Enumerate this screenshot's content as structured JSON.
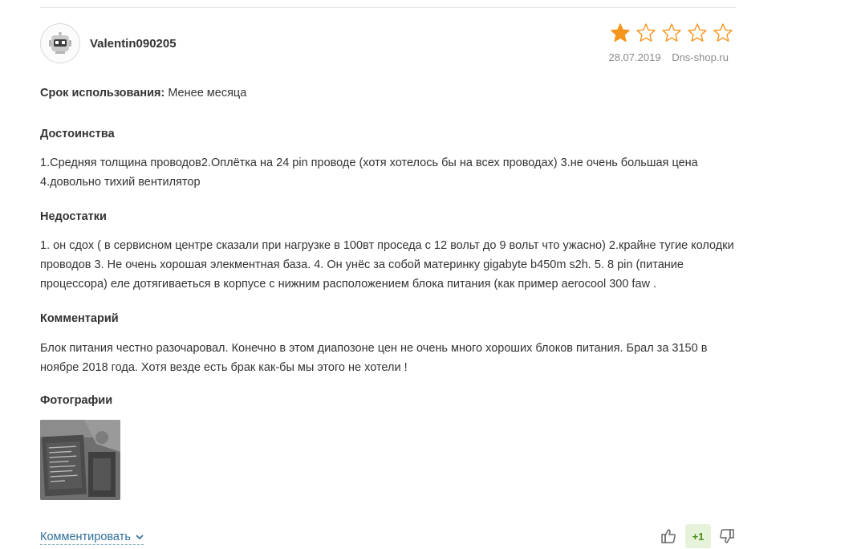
{
  "review": {
    "username": "Valentin090205",
    "rating": 1,
    "rating_max": 5,
    "date": "28.07.2019",
    "source": "Dns-shop.ru",
    "usage_label": "Срок использования:",
    "usage_value": "Менее месяца"
  },
  "sections": {
    "pros": {
      "title": "Достоинства",
      "text": "1.Средняя толщина проводов2.Оплётка на 24 pin проводе (хотя хотелось бы на всех проводах) 3.не очень большая цена 4.довольно тихий вентилятор"
    },
    "cons": {
      "title": "Недостатки",
      "text": "1. он сдох ( в сервисном центре сказали при нагрузке в 100вт проседа с 12 вольт до 9 вольт что ужасно) 2.крайне тугие колодки проводов 3. Не очень хорошая элекментная база. 4. Он унёс за собой материнку gigabyte b450m s2h. 5. 8 pin (питание процессора) еле дотягиваеться в корпусе с нижним расположением блока питания (как пример aerocool 300 faw ."
    },
    "comment": {
      "title": "Комментарий",
      "text": "Блок питания честно разочаровал.  Конечно в этом диапозоне цен не очень много хороших блоков питания. Брал за 3150 в ноябре 2018 года. Хотя везде есть брак как-бы мы этого не хотели !"
    },
    "photos": {
      "title": "Фотографии"
    }
  },
  "footer": {
    "comment_link": "Комментировать",
    "vote_count": "+1"
  },
  "colors": {
    "star_filled": "#f7941d",
    "star_empty": "#f7941d",
    "link": "#2f6f9a",
    "vote_positive": "#4a8a1c"
  },
  "icons": {
    "avatar": "robot-avatar-icon",
    "star": "star-icon",
    "chevron": "chevron-down-icon",
    "like": "thumbs-up-icon",
    "dislike": "thumbs-down-icon"
  }
}
